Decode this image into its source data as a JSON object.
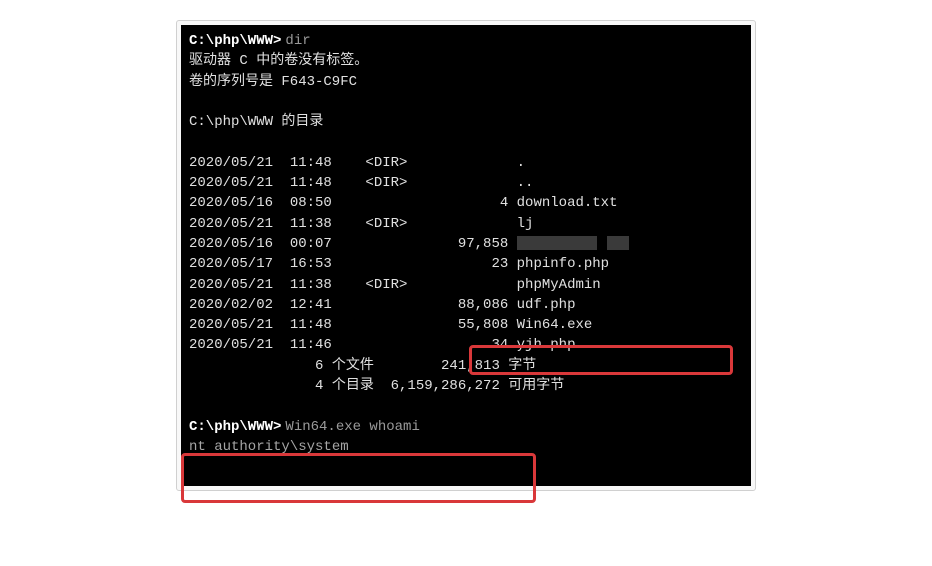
{
  "prompt1": {
    "path": "C:\\php\\WWW>",
    "command": "dir"
  },
  "header": {
    "line1": " 驱动器 C 中的卷没有标签。",
    "line2": " 卷的序列号是 F643-C9FC",
    "dirof": " C:\\php\\WWW 的目录"
  },
  "entries": [
    {
      "date": "2020/05/21",
      "time": "11:48",
      "type": "<DIR>",
      "size": "",
      "name": "."
    },
    {
      "date": "2020/05/21",
      "time": "11:48",
      "type": "<DIR>",
      "size": "",
      "name": ".."
    },
    {
      "date": "2020/05/16",
      "time": "08:50",
      "type": "",
      "size": "4",
      "name": "download.txt"
    },
    {
      "date": "2020/05/21",
      "time": "11:38",
      "type": "<DIR>",
      "size": "",
      "name": "lj"
    },
    {
      "date": "2020/05/16",
      "time": "00:07",
      "type": "",
      "size": "97,858",
      "name": ""
    },
    {
      "date": "2020/05/17",
      "time": "16:53",
      "type": "",
      "size": "23",
      "name": "phpinfo.php"
    },
    {
      "date": "2020/05/21",
      "time": "11:38",
      "type": "<DIR>",
      "size": "",
      "name": "phpMyAdmin"
    },
    {
      "date": "2020/02/02",
      "time": "12:41",
      "type": "",
      "size": "88,086",
      "name": "udf.php"
    },
    {
      "date": "2020/05/21",
      "time": "11:48",
      "type": "",
      "size": "55,808",
      "name": "Win64.exe"
    },
    {
      "date": "2020/05/21",
      "time": "11:46",
      "type": "",
      "size": "34",
      "name": "yjh.php"
    }
  ],
  "summary": {
    "files": "               6 个文件        241,813 字节",
    "dirs": "               4 个目录  6,159,286,272 可用字节"
  },
  "prompt2": {
    "path": "C:\\php\\WWW>",
    "command": "Win64.exe whoami"
  },
  "result": "nt authority\\system"
}
